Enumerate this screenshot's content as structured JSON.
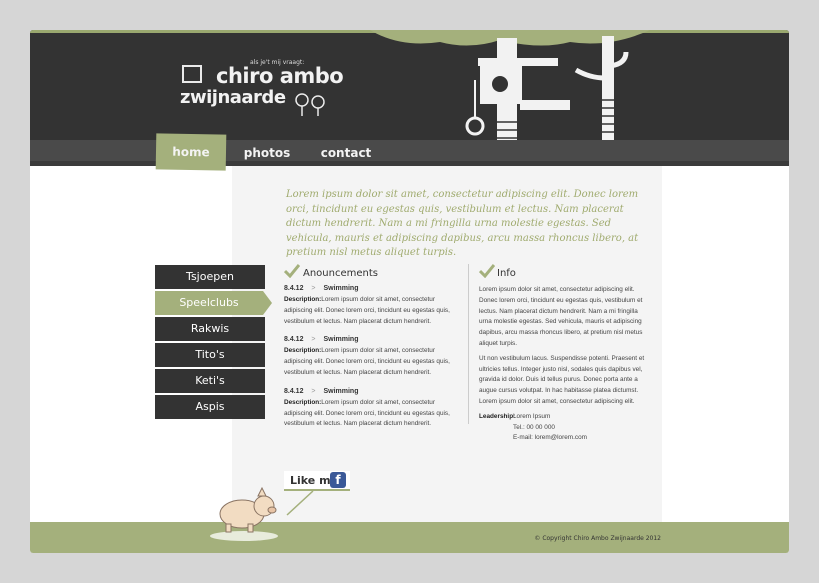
{
  "brand": {
    "tagline": "als je't mij vraagt:",
    "name_line1": "chiro ambo",
    "name_line2": "zwijnaarde"
  },
  "nav": {
    "items": [
      {
        "label": "home",
        "active": true
      },
      {
        "label": "photos",
        "active": false
      },
      {
        "label": "contact",
        "active": false
      }
    ]
  },
  "intro_text": "Lorem ipsum dolor sit amet, consectetur adipiscing elit. Donec lorem orci, tincidunt eu egestas quis, vestibulum et lectus. Nam placerat dictum hendrerit. Nam a mi fringilla urna molestie egestas. Sed vehicula, mauris et adipiscing dapibus, arcu massa rhoncus libero, at pretium nisl metus aliquet turpis.",
  "sidebar": {
    "items": [
      {
        "label": "Tsjoepen",
        "active": false
      },
      {
        "label": "Speelclubs",
        "active": true
      },
      {
        "label": "Rakwis",
        "active": false
      },
      {
        "label": "Tito's",
        "active": false
      },
      {
        "label": "Keti's",
        "active": false
      },
      {
        "label": "Aspis",
        "active": false
      }
    ]
  },
  "announcements": {
    "title": "Anouncements",
    "items": [
      {
        "date": "8.4.12",
        "arrow": ">",
        "event": "Swimming",
        "desc_label": "Description:",
        "desc": "Lorem ipsum dolor sit amet, consectetur adipiscing elit. Donec lorem orci, tincidunt eu egestas quis, vestibulum et lectus. Nam placerat dictum hendrerit."
      },
      {
        "date": "8.4.12",
        "arrow": ">",
        "event": "Swimming",
        "desc_label": "Description:",
        "desc": "Lorem ipsum dolor sit amet, consectetur adipiscing elit. Donec lorem orci, tincidunt eu egestas quis, vestibulum et lectus. Nam placerat dictum hendrerit."
      },
      {
        "date": "8.4.12",
        "arrow": ">",
        "event": "Swimming",
        "desc_label": "Description:",
        "desc": "Lorem ipsum dolor sit amet, consectetur adipiscing elit. Donec lorem orci, tincidunt eu egestas quis, vestibulum et lectus. Nam placerat dictum hendrerit."
      }
    ]
  },
  "info": {
    "title": "Info",
    "para1": "Lorem ipsum dolor sit amet, consectetur adipiscing elit. Donec lorem orci, tincidunt eu egestas quis, vestibulum et lectus. Nam placerat dictum hendrerit. Nam a mi fringilla urna molestie egestas. Sed vehicula, mauris et adipiscing dapibus, arcu massa rhoncus libero, at pretium nisl metus aliquet turpis.",
    "para2": "Ut non vestibulum lacus. Suspendisse potenti. Praesent et ultricies tellus. Integer justo nisl, sodales quis dapibus vel, gravida id dolor. Duis id tellus purus. Donec porta ante a augue cursus volutpat. In hac habitasse platea dictumst. Lorem ipsum dolor sit amet, consectetur adipiscing elit.",
    "leadership_label": "Leadership:",
    "leadership_name": "Lorem Ipsum",
    "leadership_tel": "Tel.: 00 00 000",
    "leadership_email": "E-mail: lorem@lorem.com"
  },
  "like": {
    "label": "Like me!",
    "fb_glyph": "f"
  },
  "footer": {
    "copyright": "© Copyright Chiro Ambo Zwijnaarde 2012"
  },
  "colors": {
    "accent": "#a4b07c",
    "header": "#333333",
    "intro_text": "#a0ab6f"
  }
}
